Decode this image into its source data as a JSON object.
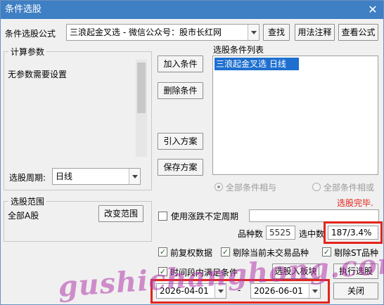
{
  "window": {
    "title": "条件选股",
    "close_glyph": "✕"
  },
  "formula": {
    "label": "条件选股公式",
    "value": "三浪起金叉选  -  微信公众号：股市长红网",
    "find_button": "查找",
    "usage_button": "用法注释",
    "view_button": "查看公式"
  },
  "params": {
    "group_label": "计算参数",
    "text": "无参数需要设置",
    "period_label": "选股周期:",
    "period_value": "日线"
  },
  "middle_buttons": {
    "add": "加入条件",
    "delete": "删除条件",
    "import": "引入方案",
    "save": "保存方案"
  },
  "conditions": {
    "label": "选股条件列表",
    "items": [
      "三浪起金叉选  日线"
    ]
  },
  "logic": {
    "all_and": "全部条件相与",
    "all_or": "全部条件相或"
  },
  "status": {
    "text": "选股完毕.",
    "color": "#e3241b"
  },
  "range": {
    "group_label": "选股范围",
    "value": "全部A股",
    "change_button": "改变范围"
  },
  "uncertain_period": {
    "label": "使用涨跌不定周期",
    "checked": false
  },
  "counts": {
    "total_label": "品种数",
    "total_value": "5525",
    "selected_label": "选中数",
    "selected_value": "187/3.4%"
  },
  "options": {
    "adjust": {
      "label": "前复权数据",
      "checked": true
    },
    "exclude_untraded": {
      "label": "剔除当前未交易品种",
      "checked": true
    },
    "exclude_st": {
      "label": "剔除ST品种",
      "checked": true
    },
    "time_range": {
      "label": "时间段内满足条件",
      "checked": true
    }
  },
  "footer": {
    "to_block_button": "选股入板块",
    "execute_button": "执行选股",
    "date_from": "2026-04-01",
    "date_sep": "-",
    "date_to": "2026-06-01",
    "close_button": "关闭"
  },
  "watermark": {
    "text": "gushichanghong.com",
    "color": "#b03aaa"
  }
}
